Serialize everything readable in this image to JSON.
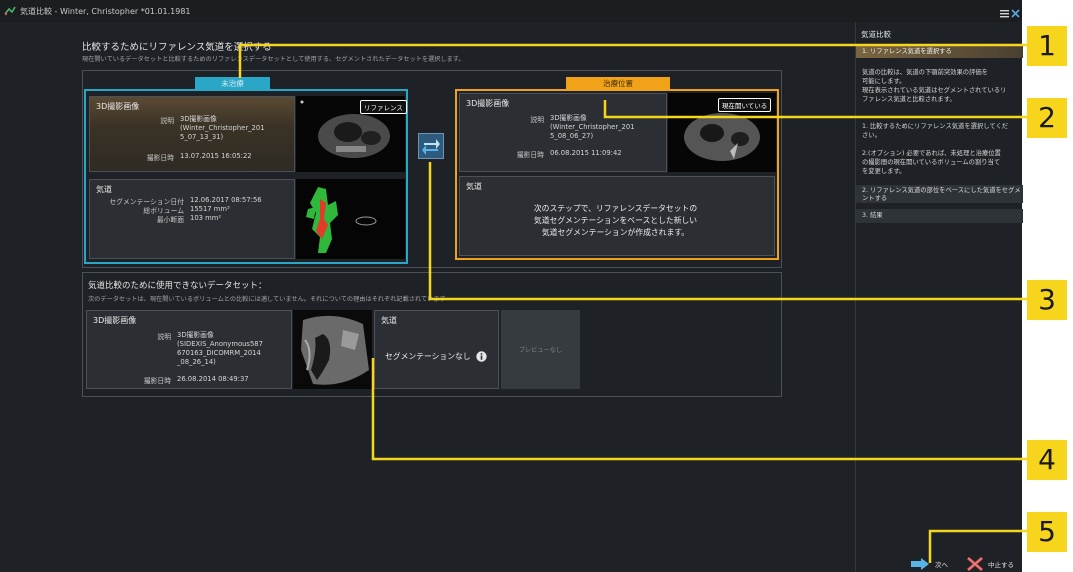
{
  "window": {
    "title": "気道比較 - Winter, Christopher *01.01.1981"
  },
  "main": {
    "heading": "比較するためにリファレンス気道を選択する",
    "subheading": "現在開いているデータセットと比較するためのリファレンスデータセットとして使用する、セグメントされたデータセットを選択します。"
  },
  "untreated": {
    "tab_label": "未治療",
    "scan_card": {
      "title": "3D撮影画像",
      "desc_label": "説明",
      "desc_lines": [
        "3D撮影画像",
        "(Winter_Christopher_201",
        "5_07_13_31)"
      ],
      "date_label": "撮影日時",
      "date_value": "13.07.2015 16:05:22",
      "badge": "リファレンス"
    },
    "airway_card": {
      "title": "気道",
      "seg_date_label": "セグメンテーション日付",
      "seg_date_value": "12.06.2017 08:57:56",
      "volume_label": "総ボリューム",
      "volume_value": "15517 mm³",
      "min_section_label": "最小断面",
      "min_section_value": "103 mm²"
    }
  },
  "treatment": {
    "tab_label": "治療位置",
    "scan_card": {
      "title": "3D撮影画像",
      "desc_label": "説明",
      "desc_lines": [
        "3D撮影画像",
        "(Winter_Christopher_201",
        "5_08_06_27)"
      ],
      "date_label": "撮影日時",
      "date_value": "06.08.2015 11:09:42",
      "badge": "現在開いている"
    },
    "airway_card": {
      "title": "気道",
      "info_lines": [
        "次のステップで、リファレンスデータセットの",
        "気道セグメンテーションをベースとした新しい",
        "気道セグメンテーションが作成されます。"
      ]
    }
  },
  "unusable": {
    "heading": "気道比較のために使用できないデータセット：",
    "subheading": "次のデータセットは、現在開いているボリュームとの比較には適していません。それについての理由はそれぞれ記載されています",
    "scan_card": {
      "title": "3D撮影画像",
      "desc_label": "説明",
      "desc_lines": [
        "3D撮影画像",
        "(SIDEXIS_Anonymous587",
        "670163_DICOMRM_2014",
        "_08_26_14)"
      ],
      "date_label": "撮影日時",
      "date_value": "26.08.2014 08:49:37"
    },
    "airway_card": {
      "title": "気道",
      "no_seg": "セグメンテーションなし"
    },
    "preview_none": "プレビューなし"
  },
  "sidebar": {
    "title": "気道比較",
    "step1": "1. リファレンス気道を選択する",
    "step1_desc": [
      "気道の比較は、気道の下顎前突効果の評価を",
      "可能にします。",
      "現在表示されている気道はセグメントされているリ",
      "ファレンス気道と比較されます。"
    ],
    "step1_sub": [
      "1. 比較するためにリファレンス気道を選択してくだ",
      "さい。"
    ],
    "step1_opt": [
      "2.(オプション) 必要であれば、未処理と治療位置",
      "の撮影間の現在開いているボリュームの割り当て",
      "を変更します。"
    ],
    "step2": [
      "2. リファレンス気道の部位をベースにした気道をセグメ",
      "ントする"
    ],
    "step3": "3. 結果"
  },
  "buttons": {
    "next": "次へ",
    "cancel": "中止する"
  },
  "callouts": [
    "1",
    "2",
    "3",
    "4",
    "5"
  ],
  "colors": {
    "accent_blue": "#2aa6c6",
    "accent_orange": "#f0a318",
    "callout_yellow": "#f7d51d"
  }
}
